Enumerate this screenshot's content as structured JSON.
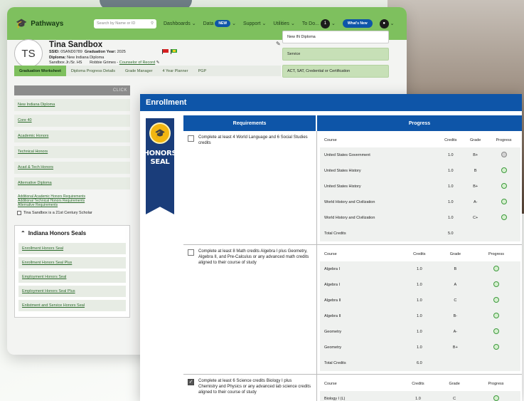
{
  "app": {
    "brand": "Pathways",
    "search_placeholder": "Search by Name or ID",
    "nav": [
      {
        "label": "Dashboards"
      },
      {
        "label": "Data"
      },
      {
        "label": "Support"
      },
      {
        "label": "Utilities"
      },
      {
        "label": "To Do..."
      }
    ],
    "data_badge": "NEW",
    "todo_count": "1",
    "whats_new": "What's New"
  },
  "student": {
    "initials": "TS",
    "name": "Tina Sandbox",
    "ssid_label": "SSID:",
    "ssid": "0SAND0789",
    "grad_year_label": "Graduation Year:",
    "grad_year": "2025",
    "diploma_label": "Diploma:",
    "diploma": "New Indiana Diploma",
    "school": "Sandbox Jr./Sr. HS",
    "counselor_name": "Robbie Grimes -",
    "counselor_link": "Counselor of Record"
  },
  "right_panel": [
    "New IN Diploma",
    "Service",
    "ACT, SAT, Credential or Certification"
  ],
  "tabs": [
    "Graduation Worksheet",
    "Diploma Progress Details",
    "Grade Manager",
    "4 Year Planner",
    "PGP"
  ],
  "side": {
    "click_label": "CLICK",
    "links": [
      "New Indiana Diploma",
      "Core 40",
      "Academic Honors",
      "Technical Honors",
      "Acad & Tech Honors",
      "Alternative Diploma"
    ],
    "extra_links": [
      "Additional Academic Honors Requirements",
      "Additional Technical Honors Requirements",
      "Alternative Requirements"
    ],
    "scholar_label": "Tina Sandbox is a 21st Century Scholar",
    "seals_title": "Indiana Honors Seals",
    "seals": [
      "Enrollment Honors Seal",
      "Enrollment Honors Seal Plus",
      "Employment Honors Seal",
      "Employment Honors Seal Plus",
      "Enlistment and Service Honors Seal"
    ]
  },
  "enrollment": {
    "title": "Enrollment",
    "banner_text": "HONORS SEAL",
    "col_requirements": "Requirements",
    "col_progress": "Progress",
    "table_headers": [
      "Course",
      "Credits",
      "Grade",
      "Progress"
    ],
    "total_label": "Total Credits",
    "rows": [
      {
        "requirement": "Complete at least 4 World Language and 6 Social Studies credits",
        "checked": false,
        "courses": [
          {
            "course": "United States Government",
            "credits": "1.0",
            "grade": "B+",
            "status": "pending"
          },
          {
            "course": "United States History",
            "credits": "1.0",
            "grade": "B",
            "status": "complete"
          },
          {
            "course": "United States History",
            "credits": "1.0",
            "grade": "B+",
            "status": "complete"
          },
          {
            "course": "World History and Civilization",
            "credits": "1.0",
            "grade": "A-",
            "status": "complete"
          },
          {
            "course": "World History and Civilization",
            "credits": "1.0",
            "grade": "C+",
            "status": "complete"
          }
        ],
        "total": "5.0"
      },
      {
        "requirement": "Complete at least 8 Math credits Algebra I plus Geometry, Algebra II, and Pre-Calculus or any advanced math credits aligned to their course of study",
        "checked": false,
        "courses": [
          {
            "course": "Algebra I",
            "credits": "1.0",
            "grade": "B",
            "status": "complete"
          },
          {
            "course": "Algebra I",
            "credits": "1.0",
            "grade": "A",
            "status": "complete"
          },
          {
            "course": "Algebra II",
            "credits": "1.0",
            "grade": "C",
            "status": "complete"
          },
          {
            "course": "Algebra II",
            "credits": "1.0",
            "grade": "B-",
            "status": "complete"
          },
          {
            "course": "Geometry",
            "credits": "1.0",
            "grade": "A-",
            "status": "complete"
          },
          {
            "course": "Geometry",
            "credits": "1.0",
            "grade": "B+",
            "status": "complete"
          }
        ],
        "total": "6.0"
      },
      {
        "requirement": "Complete at least 6 Science credits Biology I plus Chemistry and Physics or any advanced lab science credits aligned to their course of study",
        "checked": true,
        "courses": [
          {
            "course": "Biology I (L)",
            "credits": "1.0",
            "grade": "C",
            "status": "complete"
          }
        ],
        "total": ""
      }
    ]
  },
  "colors": {
    "topbar_green": "#7ec05e",
    "primary_blue": "#0e55a8",
    "seal_navy": "#1a3d7a",
    "seal_gold": "#f2b611"
  }
}
